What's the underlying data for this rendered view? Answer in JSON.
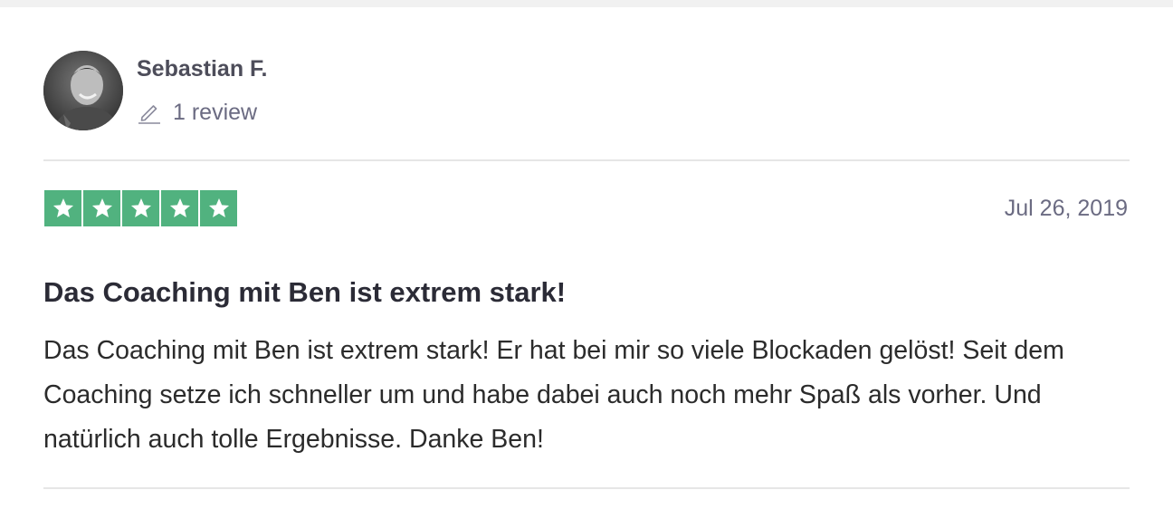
{
  "review": {
    "author": {
      "name": "Sebastian F.",
      "review_count": "1 review",
      "avatar_icon": "user-avatar-photo",
      "count_icon": "pencil-icon"
    },
    "rating": {
      "stars": 5,
      "max": 5,
      "star_color": "#51b27f"
    },
    "date": "Jul 26, 2019",
    "title": "Das Coaching mit Ben ist extrem stark!",
    "body": "Das Coaching mit Ben ist extrem stark! Er hat bei mir so viele Blockaden gelöst! Seit dem Coaching setze ich schneller um und habe dabei auch noch mehr Spaß als vorher. Und natürlich auch tolle Ergebnisse. Danke Ben!"
  }
}
